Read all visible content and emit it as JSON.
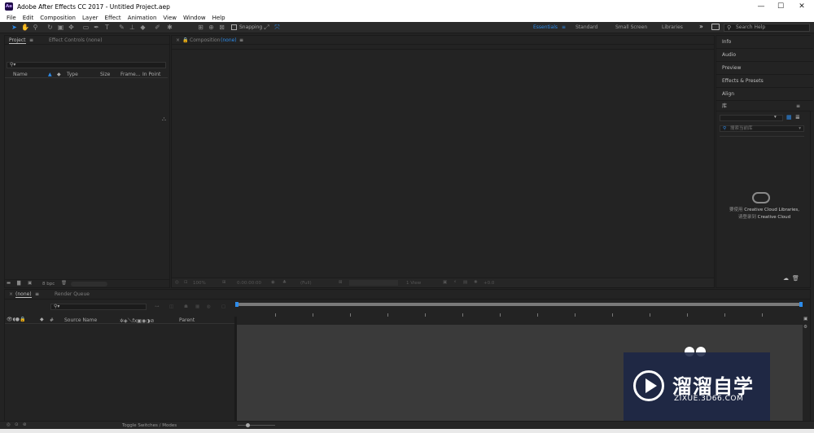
{
  "window": {
    "logo": "Ae",
    "title": "Adobe After Effects CC 2017 - Untitled Project.aep",
    "controls": [
      "—",
      "☐",
      "✕"
    ]
  },
  "menu": [
    "File",
    "Edit",
    "Composition",
    "Layer",
    "Effect",
    "Animation",
    "View",
    "Window",
    "Help"
  ],
  "toolbar": {
    "snapping_label": "Snapping",
    "workspaces": [
      "Essentials",
      "Standard",
      "Small Screen",
      "Libraries"
    ],
    "active_workspace": "Essentials",
    "overflow": "»",
    "search_placeholder": "Search Help"
  },
  "project_panel": {
    "tabs": [
      "Project",
      "Effect Controls (none)"
    ],
    "search_icon_glyph": "⚲▾",
    "columns": [
      "Name",
      "Type",
      "Size",
      "Frame...",
      "In Point"
    ],
    "bpc_label": "8 bpc"
  },
  "composition_panel": {
    "tab_label": "Composition",
    "tab_value": "(none)",
    "bottom_values": [
      "100%",
      "0:00:00:00",
      "(Full)",
      "1 View",
      "+0.0"
    ]
  },
  "right_panels": {
    "items": [
      "Info",
      "Audio",
      "Preview",
      "Effects & Presets",
      "Align"
    ],
    "library_title": "库",
    "library_search_placeholder": "搜索当前库",
    "cc_message_prefix_1": "要使用",
    "cc_message_bold_1": "Creative Cloud Libraries,",
    "cc_message_prefix_2": "请登录到",
    "cc_message_bold_2": "Creative Cloud"
  },
  "timeline": {
    "tabs": [
      "(none)",
      "Render Queue"
    ],
    "search_icon_glyph": "⚲▾",
    "columns": [
      "#",
      "Source Name",
      "Parent"
    ],
    "toggle_label": "Toggle Switches / Modes"
  },
  "watermark": {
    "chinese_text": "溜溜自学",
    "english_text": "ZIXUE.3D66.COM"
  },
  "colors": {
    "accent": "#2d8ceb",
    "panel_bg": "#232323",
    "timeline_bg": "#3a3a3a"
  }
}
